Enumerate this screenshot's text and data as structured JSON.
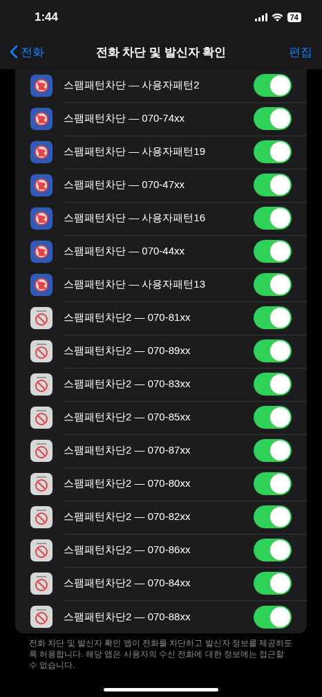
{
  "status_bar": {
    "time": "1:44",
    "battery": "74"
  },
  "nav": {
    "back": "전화",
    "title": "전화 차단 및 발신자 확인",
    "action": "편집"
  },
  "apps": [
    {
      "label": "스팸패턴차단 — 사용자패턴2",
      "kind": "phone",
      "on": true
    },
    {
      "label": "스팸패턴차단 — 070-74xx",
      "kind": "phone",
      "on": true
    },
    {
      "label": "스팸패턴차단 — 사용자패턴19",
      "kind": "phone",
      "on": true
    },
    {
      "label": "스팸패턴차단 — 070-47xx",
      "kind": "phone",
      "on": true
    },
    {
      "label": "스팸패턴차단 — 사용자패턴16",
      "kind": "phone",
      "on": true
    },
    {
      "label": "스팸패턴차단 — 070-44xx",
      "kind": "phone",
      "on": true
    },
    {
      "label": "스팸패턴차단 — 사용자패턴13",
      "kind": "phone",
      "on": true
    },
    {
      "label": "스팸패턴차단2 — 070-81xx",
      "kind": "prohibit",
      "on": true
    },
    {
      "label": "스팸패턴차단2 — 070-89xx",
      "kind": "prohibit",
      "on": true
    },
    {
      "label": "스팸패턴차단2 — 070-83xx",
      "kind": "prohibit",
      "on": true
    },
    {
      "label": "스팸패턴차단2 — 070-85xx",
      "kind": "prohibit",
      "on": true
    },
    {
      "label": "스팸패턴차단2 — 070-87xx",
      "kind": "prohibit",
      "on": true
    },
    {
      "label": "스팸패턴차단2 — 070-80xx",
      "kind": "prohibit",
      "on": true
    },
    {
      "label": "스팸패턴차단2 — 070-82xx",
      "kind": "prohibit",
      "on": true
    },
    {
      "label": "스팸패턴차단2 — 070-86xx",
      "kind": "prohibit",
      "on": true
    },
    {
      "label": "스팸패턴차단2 — 070-84xx",
      "kind": "prohibit",
      "on": true
    },
    {
      "label": "스팸패턴차단2 — 070-88xx",
      "kind": "prohibit",
      "on": true
    }
  ],
  "footer": "전화 차단 및 발신자 확인 앱이 전화를 차단하고 발신자 정보를 제공하도록 허용합니다. 해당 앱은 사용자의 수신 전화에 대한 정보에는 접근할 수 없습니다."
}
